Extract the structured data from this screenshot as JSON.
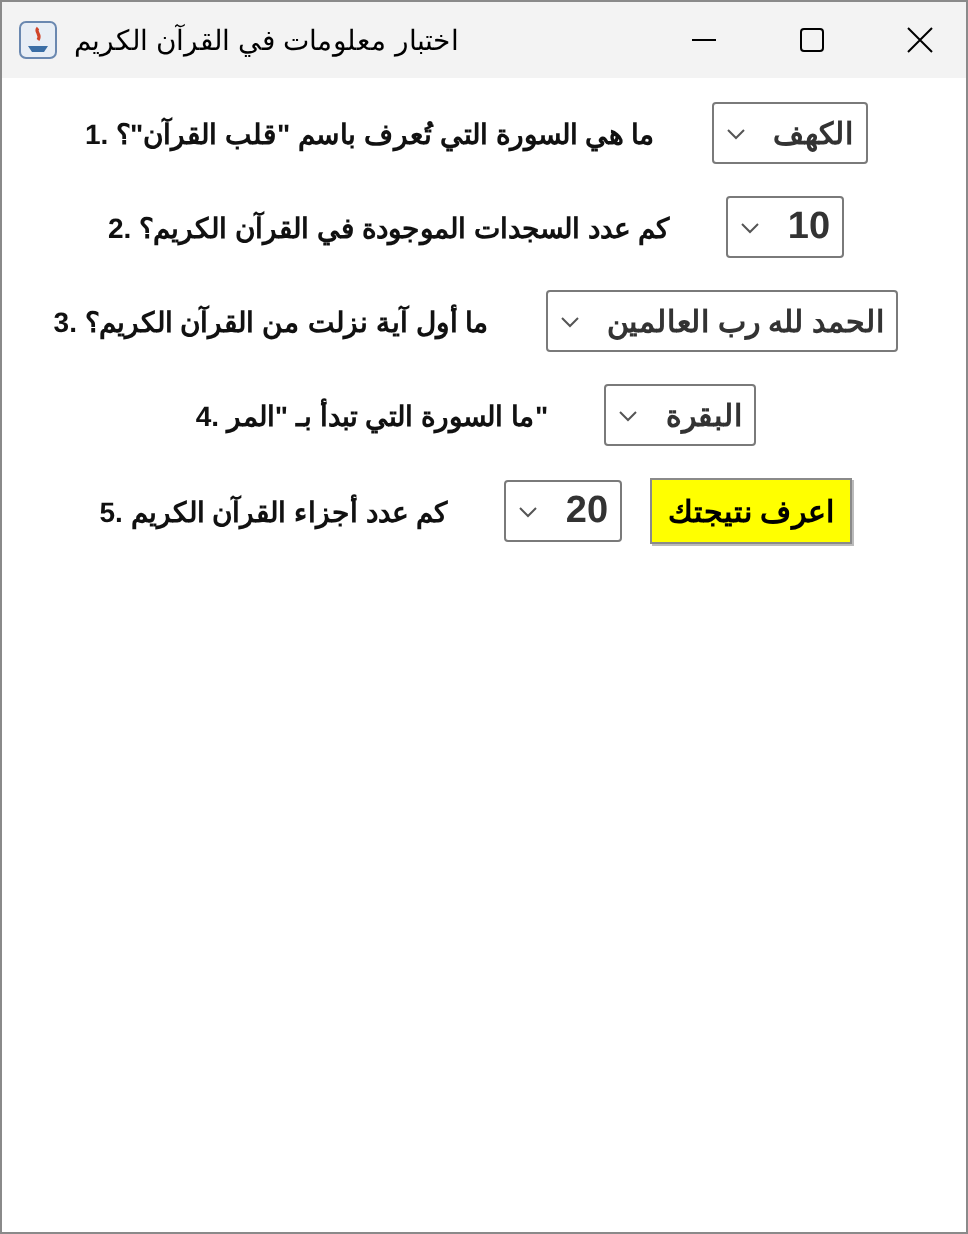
{
  "window": {
    "title": "اختبار معلومات في القرآن الكريم"
  },
  "questions": [
    {
      "label": "1. ما هي السورة التي تُعرف باسم \"قلب القرآن\"؟",
      "answer": "الكهف"
    },
    {
      "label": "2. كم عدد السجدات الموجودة في القرآن الكريم؟",
      "answer": "10"
    },
    {
      "label": "3. ما أول آية نزلت من القرآن الكريم؟",
      "answer": "الحمد لله رب العالمين"
    },
    {
      "label": "4. ما السورة التي تبدأ بـ \"المر\"",
      "answer": "البقرة"
    },
    {
      "label": "5. كم عدد أجزاء القرآن الكريم",
      "answer": "20"
    }
  ],
  "submit_button": "اعرف نتيجتك"
}
